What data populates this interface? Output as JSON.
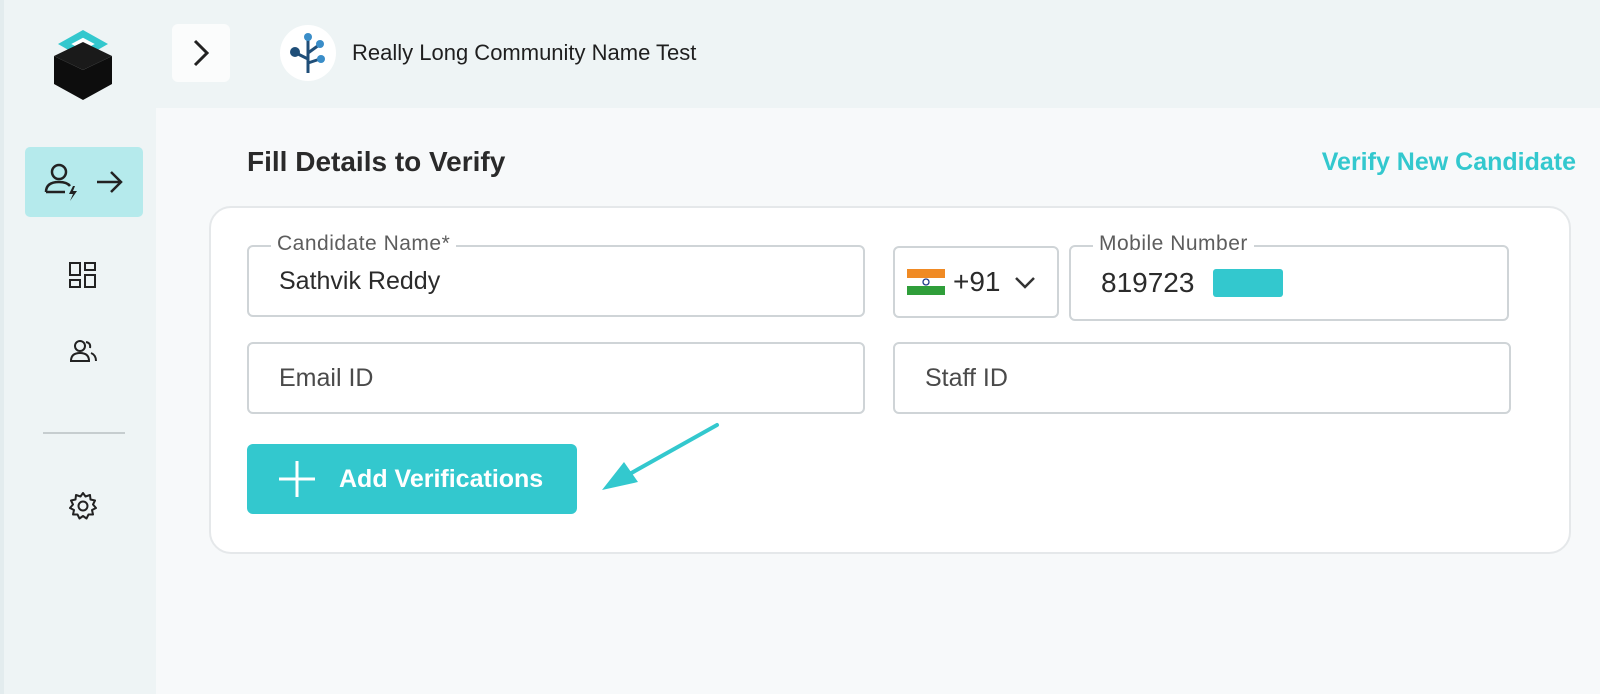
{
  "header": {
    "community_name": "Really Long Community Name Test"
  },
  "sidebar": {
    "items": [
      {
        "name": "verify-candidate",
        "icon": "user-verify-arrow-icon",
        "active": true
      },
      {
        "name": "dashboard",
        "icon": "grid-icon"
      },
      {
        "name": "candidates",
        "icon": "users-icon"
      },
      {
        "name": "settings",
        "icon": "gear-icon"
      }
    ]
  },
  "main": {
    "title": "Fill Details to Verify",
    "verify_new_link": "Verify New Candidate",
    "form": {
      "candidate_name": {
        "label": "Candidate Name*",
        "value": "Sathvik Reddy"
      },
      "country": {
        "flag": "india-flag-icon",
        "code": "+91"
      },
      "mobile": {
        "label": "Mobile Number",
        "value": "819723"
      },
      "email": {
        "placeholder": "Email ID"
      },
      "staff_id": {
        "placeholder": "Staff ID"
      }
    },
    "add_button": "Add Verifications"
  },
  "colors": {
    "accent": "#33c8ce",
    "active_nav": "#b5eaec",
    "background": "#eef4f5"
  }
}
